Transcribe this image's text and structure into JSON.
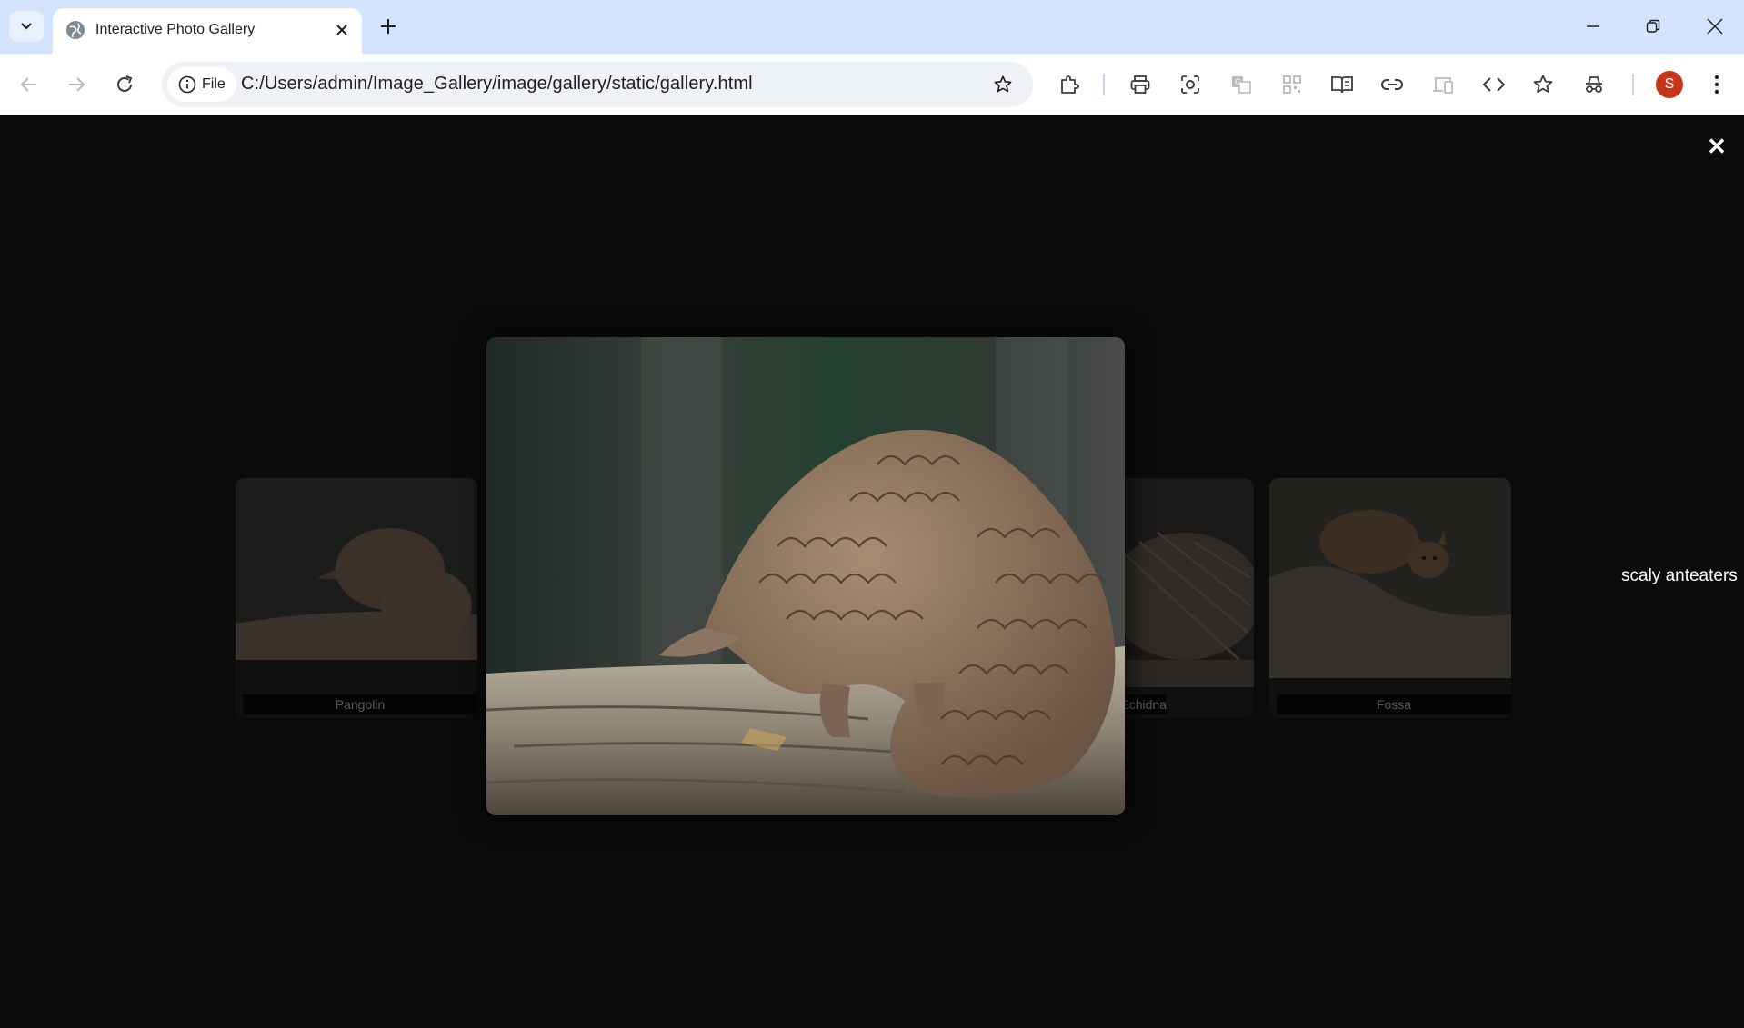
{
  "browser": {
    "tab_title": "Interactive Photo Gallery",
    "security_chip_label": "File",
    "url": "C:/Users/admin/Image_Gallery/image/gallery/static/gallery.html",
    "profile_initial": "S",
    "profile_color": "#c5361b"
  },
  "lightbox": {
    "caption": "scaly anteaters",
    "close_symbol": "✕",
    "thumbnails": [
      {
        "label": "Pangolin"
      },
      {
        "label": "Echidna"
      },
      {
        "label": "Fossa"
      }
    ]
  }
}
